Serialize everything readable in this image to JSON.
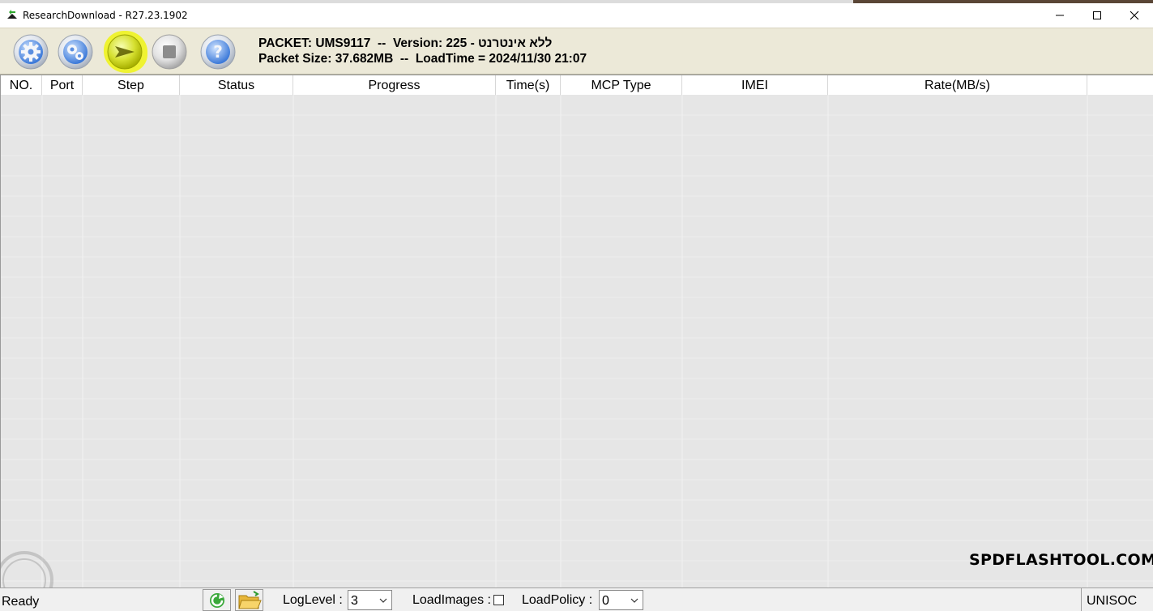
{
  "window": {
    "title": "ResearchDownload - R27.23.1902"
  },
  "toolbar": {
    "buttons": [
      {
        "name": "load-packet",
        "icon": "gear-icon"
      },
      {
        "name": "settings",
        "icon": "gears-icon"
      },
      {
        "name": "start-download",
        "icon": "play-arrow-icon"
      },
      {
        "name": "stop-download",
        "icon": "stop-icon"
      },
      {
        "name": "help",
        "icon": "question-icon"
      }
    ],
    "packet_line": "PACKET: UMS9117  --  Version: 225 - ללא אינטרנט",
    "size_line": "Packet Size: 37.682MB  --  LoadTime = 2024/11/30 21:07"
  },
  "grid": {
    "columns": [
      "NO.",
      "Port",
      "Step",
      "Status",
      "Progress",
      "Time(s)",
      "MCP Type",
      "IMEI",
      "Rate(MB/s)",
      ""
    ]
  },
  "watermark": "SPDFLASHTOOL.COM",
  "statusbar": {
    "status": "Ready",
    "loglevel_label": "LogLevel :",
    "loglevel_value": "3",
    "loadimages_label": "LoadImages :",
    "loadimages_checked": false,
    "loadpolicy_label": "LoadPolicy :",
    "loadpolicy_value": "0",
    "vendor": "UNISOC"
  },
  "colors": {
    "toolbar_bg": "#ece9d8",
    "grid_bg": "#e6e6e6",
    "highlight": "#f0f514"
  }
}
